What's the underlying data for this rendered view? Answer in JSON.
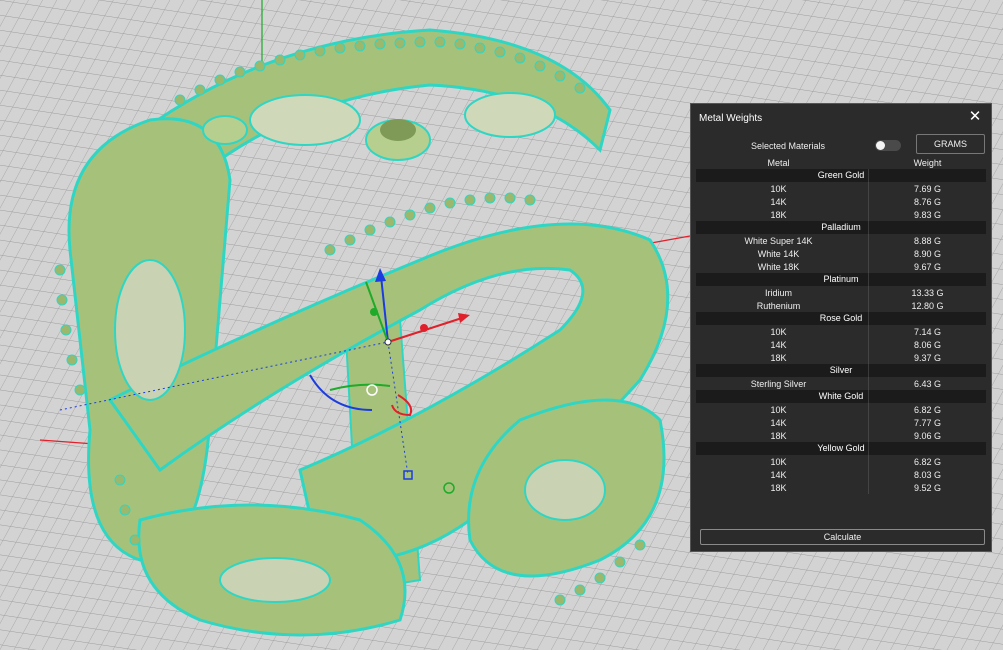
{
  "panel": {
    "title": "Metal Weights",
    "close_icon": "close-icon",
    "selected_materials_label": "Selected Materials",
    "selected_materials_on": false,
    "unit_button": "GRAMS",
    "columns": {
      "metal": "Metal",
      "weight": "Weight"
    },
    "groups": [
      {
        "name": "Green Gold",
        "rows": [
          {
            "metal": "10K",
            "weight": "7.69 G"
          },
          {
            "metal": "14K",
            "weight": "8.76 G"
          },
          {
            "metal": "18K",
            "weight": "9.83 G"
          }
        ]
      },
      {
        "name": "Palladium",
        "rows": [
          {
            "metal": "White Super 14K",
            "weight": "8.88 G"
          },
          {
            "metal": "White 14K",
            "weight": "8.90 G"
          },
          {
            "metal": "White 18K",
            "weight": "9.67 G"
          }
        ]
      },
      {
        "name": "Platinum",
        "rows": [
          {
            "metal": "Iridium",
            "weight": "13.33 G"
          },
          {
            "metal": "Ruthenium",
            "weight": "12.80 G"
          }
        ]
      },
      {
        "name": "Rose Gold",
        "rows": [
          {
            "metal": "10K",
            "weight": "7.14 G"
          },
          {
            "metal": "14K",
            "weight": "8.06 G"
          },
          {
            "metal": "18K",
            "weight": "9.37 G"
          }
        ]
      },
      {
        "name": "Silver",
        "rows": [
          {
            "metal": "Sterling Silver",
            "weight": "6.43 G"
          }
        ]
      },
      {
        "name": "White Gold",
        "rows": [
          {
            "metal": "10K",
            "weight": "6.82 G"
          },
          {
            "metal": "14K",
            "weight": "7.77 G"
          },
          {
            "metal": "18K",
            "weight": "9.06 G"
          }
        ]
      },
      {
        "name": "Yellow Gold",
        "rows": [
          {
            "metal": "10K",
            "weight": "6.82 G"
          },
          {
            "metal": "14K",
            "weight": "8.03 G"
          },
          {
            "metal": "18K",
            "weight": "9.52 G"
          }
        ]
      }
    ],
    "calculate_button": "Calculate"
  },
  "colors": {
    "viewport_bg": "#cfcfcf",
    "grid_line": "#9a9a9a",
    "model_fill": "#a6c27a",
    "wireframe": "#2fd6c4",
    "axis_x": "#e0202a",
    "axis_y": "#1faa2a",
    "axis_z": "#1c3ce0",
    "panel_bg": "#2b2b2b"
  }
}
